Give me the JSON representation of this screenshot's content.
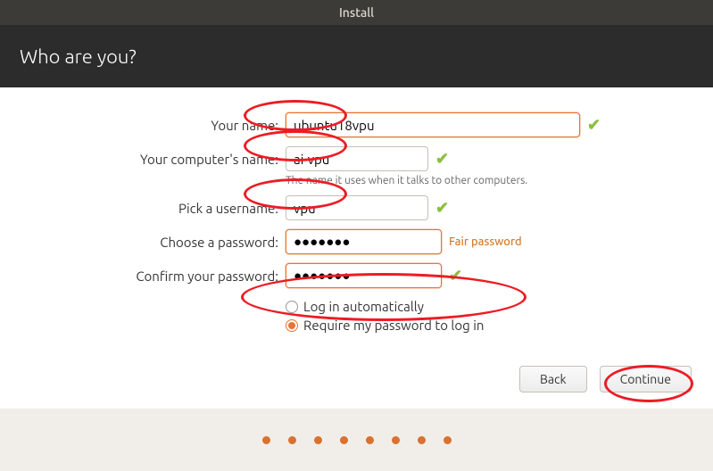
{
  "window": {
    "title": "Install"
  },
  "header": {
    "title": "Who are you?"
  },
  "form": {
    "name_label": "Your name:",
    "name_value": "ubuntu18vpu",
    "computer_label": "Your computer's name:",
    "computer_value": "ai-vpu",
    "computer_hint": "The name it uses when it talks to other computers.",
    "username_label": "Pick a username:",
    "username_value": "vpu",
    "password_label": "Choose a password:",
    "password_value": "●●●●●●●",
    "password_strength": "Fair password",
    "confirm_label": "Confirm your password:",
    "confirm_value": "●●●●●●●",
    "auto_login_label": "Log in automatically",
    "require_pw_label": "Require my password to log in"
  },
  "buttons": {
    "back": "Back",
    "continue": "Continue"
  }
}
